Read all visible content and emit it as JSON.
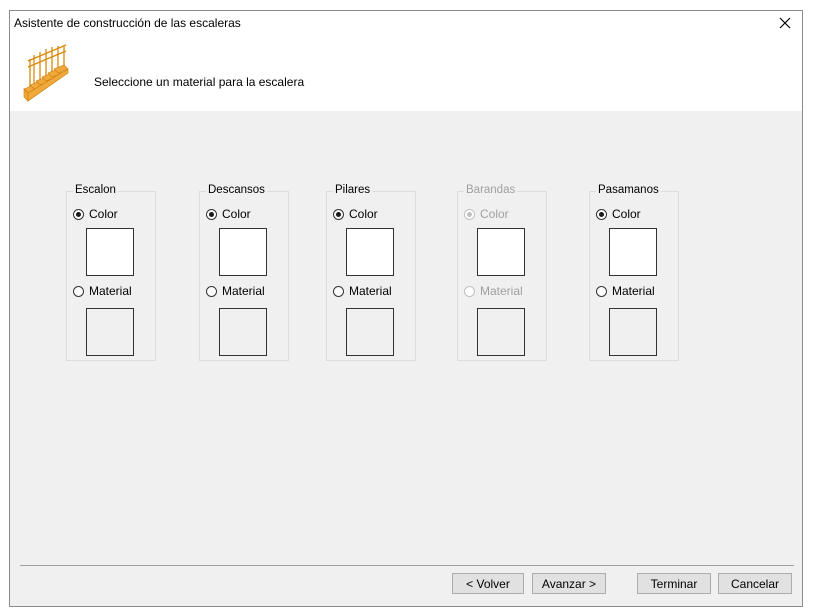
{
  "window": {
    "title": "Asistente de construcción de las escaleras"
  },
  "header": {
    "subtitle": "Seleccione un material para la escalera"
  },
  "groups": [
    {
      "label": "Escalon",
      "color_label": "Color",
      "material_label": "Material",
      "selected": "color",
      "enabled": true,
      "color_value": "#ffffff"
    },
    {
      "label": "Descansos",
      "color_label": "Color",
      "material_label": "Material",
      "selected": "color",
      "enabled": true,
      "color_value": "#ffffff"
    },
    {
      "label": "Pilares",
      "color_label": "Color",
      "material_label": "Material",
      "selected": "color",
      "enabled": true,
      "color_value": "#ffffff"
    },
    {
      "label": "Barandas",
      "color_label": "Color",
      "material_label": "Material",
      "selected": "color",
      "enabled": false,
      "color_value": "#ffffff"
    },
    {
      "label": "Pasamanos",
      "color_label": "Color",
      "material_label": "Material",
      "selected": "color",
      "enabled": true,
      "color_value": "#ffffff"
    }
  ],
  "buttons": {
    "back": "< Volver",
    "next": "Avanzar >",
    "finish": "Terminar",
    "cancel": "Cancelar"
  },
  "icons": {
    "close": "close-icon",
    "app": "staircase-icon"
  }
}
